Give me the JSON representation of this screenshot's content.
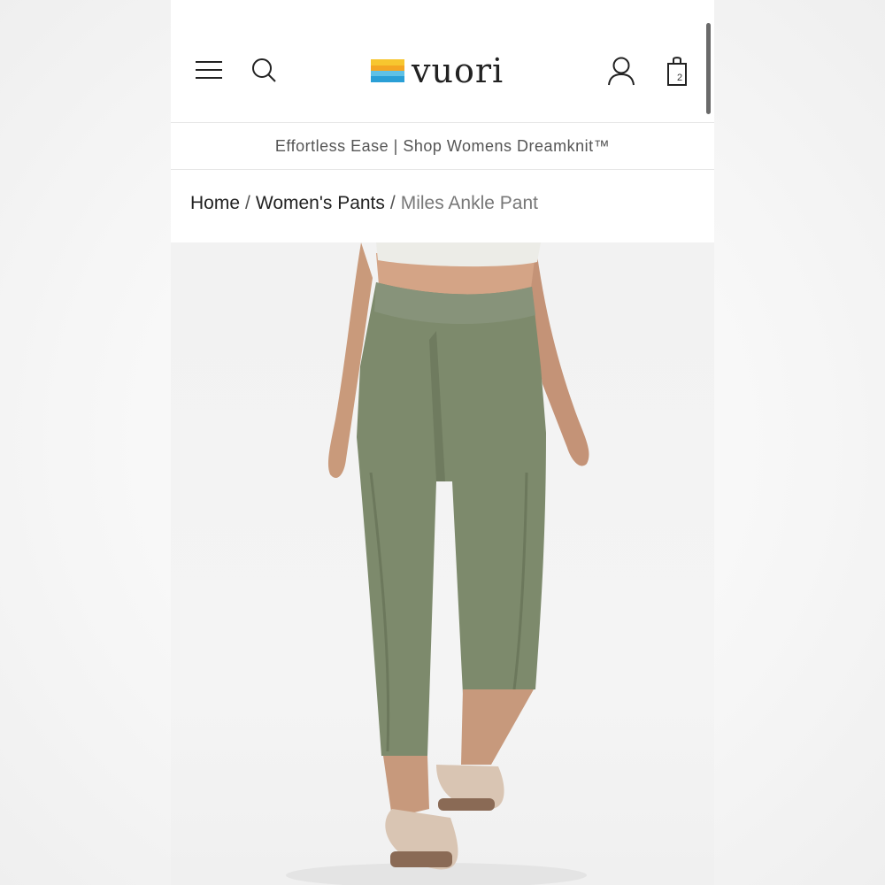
{
  "header": {
    "brand": "vuori",
    "cart_count": "2",
    "icons": {
      "menu": "hamburger-menu-icon",
      "search": "search-icon",
      "account": "account-icon",
      "bag": "shopping-bag-icon"
    },
    "brand_colors": [
      "#f7c62f",
      "#f4a623",
      "#5fc1e6",
      "#2a9fd6"
    ]
  },
  "promo_banner": {
    "text": "Effortless Ease | Shop Womens Dreamknit™"
  },
  "breadcrumb": {
    "items": [
      "Home",
      "Women's Pants",
      "Miles Ankle Pant"
    ],
    "separator": "/"
  },
  "product_image": {
    "pant_color": "#7d8a6c",
    "top_color": "#eeeeea"
  }
}
